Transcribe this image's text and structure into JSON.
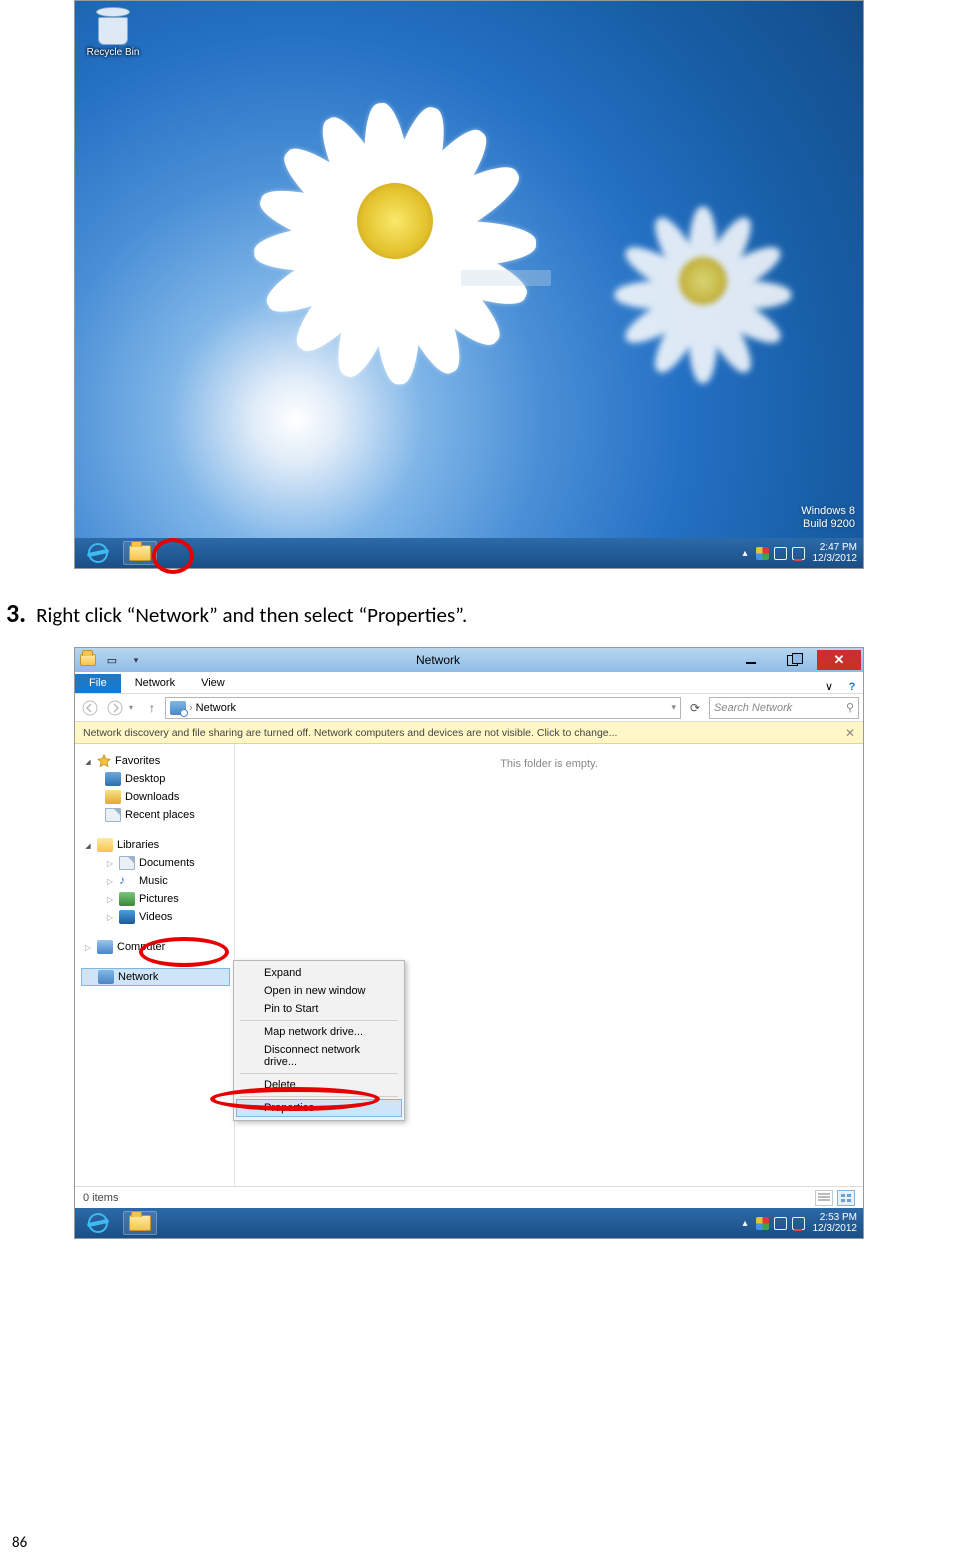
{
  "page_number": "86",
  "step": {
    "number": "3.",
    "text": "Right click “Network” and then select “Properties”."
  },
  "shot1": {
    "desktop_icons": {
      "recycle_bin": "Recycle Bin"
    },
    "build_tag": {
      "line1": "Windows 8",
      "line2": "Build 9200"
    },
    "taskbar": {
      "tray_chevron": "▴",
      "clock_time": "2:47 PM",
      "clock_date": "12/3/2012"
    }
  },
  "shot2": {
    "titlebar": {
      "title": "Network",
      "close": "✕"
    },
    "ribbon": {
      "file": "File",
      "tabs": [
        "Network",
        "View"
      ],
      "expand": "∨",
      "help": "?"
    },
    "nav": {
      "back": "←",
      "fwd": "→",
      "hist": "▾",
      "up": "↑",
      "breadcrumb_icon_chevron": "›",
      "breadcrumb": "Network",
      "dropdown": "▾",
      "refresh": "⟳",
      "search_placeholder": "Search Network",
      "search_icon": "⚲"
    },
    "infobar": {
      "text": "Network discovery and file sharing are turned off. Network computers and devices are not visible. Click to change...",
      "close": "✕"
    },
    "sidebar": {
      "favorites": {
        "label": "Favorites",
        "items": [
          "Desktop",
          "Downloads",
          "Recent places"
        ]
      },
      "libraries": {
        "label": "Libraries",
        "items": [
          "Documents",
          "Music",
          "Pictures",
          "Videos"
        ]
      },
      "computer": {
        "label": "Computer"
      },
      "network": {
        "label": "Network"
      }
    },
    "content": {
      "empty": "This folder is empty."
    },
    "context_menu": {
      "items1": [
        "Expand",
        "Open in new window",
        "Pin to Start"
      ],
      "items2": [
        "Map network drive...",
        "Disconnect network drive..."
      ],
      "items3": [
        "Delete"
      ],
      "items4": [
        "Properties"
      ]
    },
    "status": {
      "text": "0 items"
    },
    "taskbar": {
      "tray_chevron": "▴",
      "clock_time": "2:53 PM",
      "clock_date": "12/3/2012"
    }
  }
}
